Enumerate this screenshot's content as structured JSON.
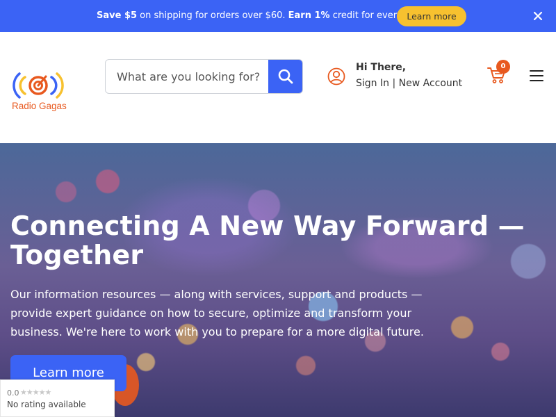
{
  "colors": {
    "brand_blue": "#3b63f5",
    "accent_yellow": "#f7c12f",
    "brand_orange": "#e8591f"
  },
  "promo": {
    "save_strong": "Save $5",
    "save_text": " on shipping for orders over $60. ",
    "earn_strong": "Earn 1%",
    "earn_text": " credit for every order.",
    "button_label": "Learn more",
    "close_icon": "close-icon"
  },
  "header": {
    "logo_text": "Radio Gagas",
    "search": {
      "placeholder": "What are you looking for?",
      "value": "",
      "icon": "search-icon"
    },
    "account": {
      "greeting": "Hi There,",
      "sign_in": "Sign In",
      "separator": " | ",
      "new_account": "New Account",
      "icon": "user-icon"
    },
    "cart": {
      "count": "0",
      "icon": "cart-icon"
    },
    "menu_icon": "hamburger-menu-icon"
  },
  "hero": {
    "title": "Connecting A New Way Forward — Together",
    "body": "Our information resources — along with services, support and products — provide expert guidance on how to secure, optimize and transform your business. We're here to work with you to prepare for a more digital future.",
    "button_label": "Learn more"
  },
  "rating_widget": {
    "score": "0.0",
    "stars": "★★★★★",
    "text": "No rating available"
  }
}
